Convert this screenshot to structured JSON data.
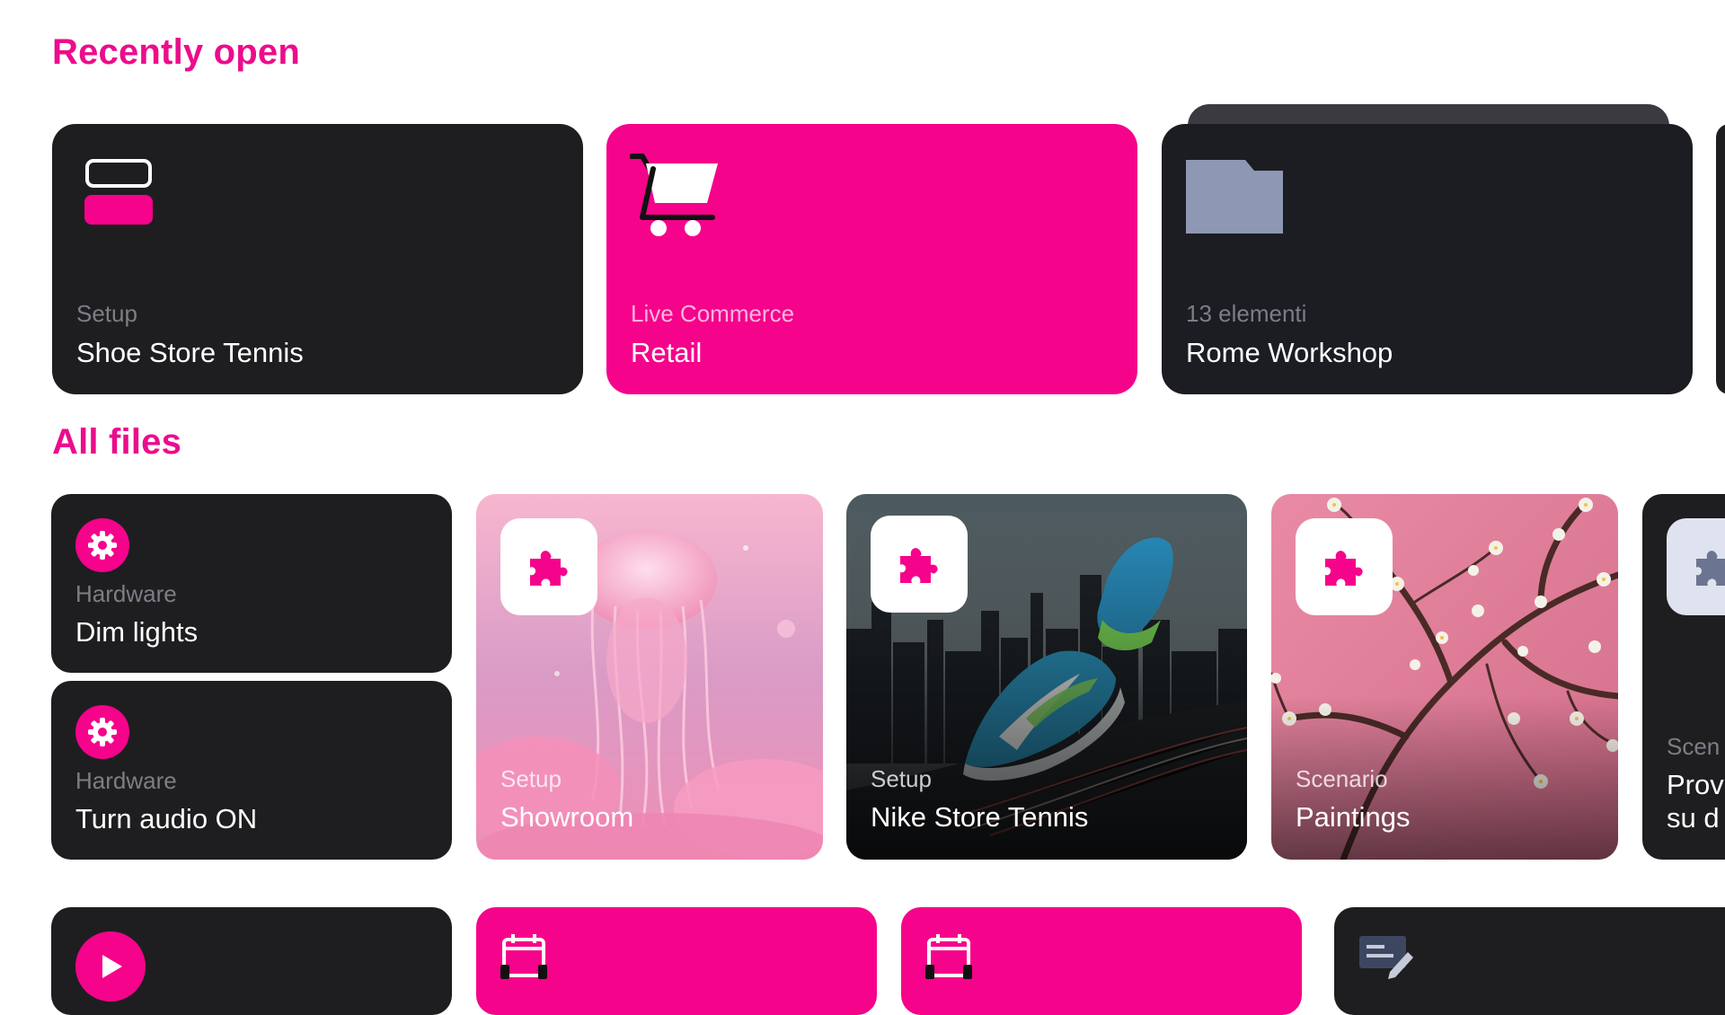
{
  "sections": {
    "recent_title": "Recently open",
    "all_title": "All files"
  },
  "recent": [
    {
      "subtitle": "Setup",
      "title": "Shoe Store Tennis",
      "icon": "layout-icon"
    },
    {
      "subtitle": "Live Commerce",
      "title": "Retail",
      "icon": "cart-icon"
    },
    {
      "subtitle": "13 elementi",
      "title": "Rome Workshop",
      "icon": "folder-icon"
    }
  ],
  "files": [
    {
      "subtitle": "Hardware",
      "title": "Dim lights",
      "icon": "gear-icon"
    },
    {
      "subtitle": "Hardware",
      "title": "Turn audio ON",
      "icon": "gear-icon"
    },
    {
      "subtitle": "Setup",
      "title": "Showroom",
      "icon": "puzzle-icon",
      "image": "jellyfish-image"
    },
    {
      "subtitle": "Setup",
      "title": "Nike Store Tennis",
      "icon": "puzzle-icon",
      "image": "sneakers-city-image"
    },
    {
      "subtitle": "Scenario",
      "title": "Paintings",
      "icon": "puzzle-icon",
      "image": "blossom-painting-image"
    },
    {
      "subtitle": "Scen",
      "title": "Prov",
      "title2": "su d",
      "icon": "puzzle-icon"
    }
  ],
  "bottom_row": [
    {
      "icon": "play-icon"
    },
    {
      "icon": "calendar-icon"
    },
    {
      "icon": "calendar-icon"
    },
    {
      "icon": "edit-icon"
    }
  ],
  "colors": {
    "accent": "#f5038b",
    "card_dark": "#1e1e20",
    "folder": "#8e97b3"
  }
}
